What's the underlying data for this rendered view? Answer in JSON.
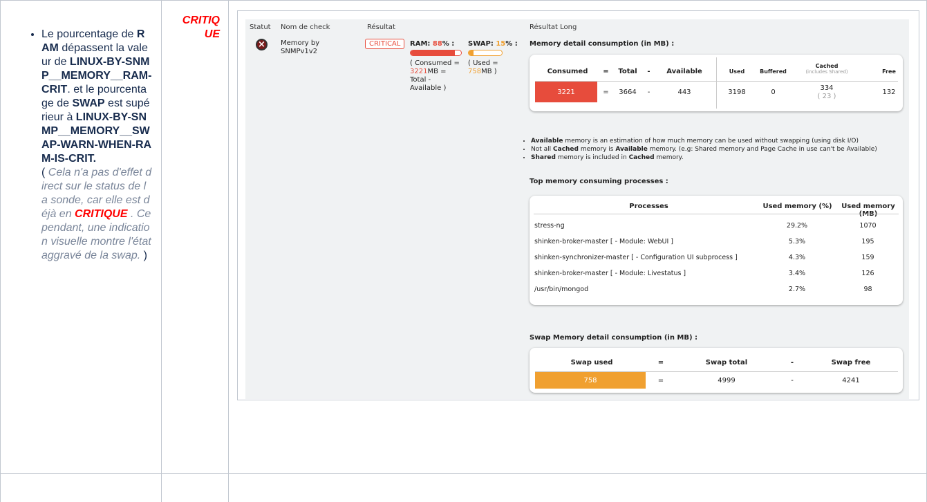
{
  "colors": {
    "critical": "#e74c3c",
    "warning": "#f0a030",
    "border": "#c1c7d0"
  },
  "column1": {
    "t1": "Le pourcentage de ",
    "b1": "RAM",
    "t2": " dépassent la valeur de ",
    "b2": "LINUX-BY-SNMP__MEMORY__RAM-CRIT",
    "t3": ". et le pourcentage de ",
    "b3": "SWAP",
    "t4": " est supérieur à ",
    "b4": "LINUX-BY-SNMP__MEMORY__SWAP-WARN-WHEN-RAM-IS-CRIT.",
    "paren_open": "(",
    "g1": "Cela n'a pas d'effet direct sur le status de la sonde, car elle est déjà en ",
    "red": "CRITIQUE",
    "g2": " . Cependant,  une indication visuelle montre l'état aggravé de la swap.",
    "paren_close": " )"
  },
  "column2": {
    "status": "CRITIQUE"
  },
  "check": {
    "headers": {
      "status": "Statut",
      "name": "Nom de check",
      "result": "Résultat",
      "long": "Résultat Long"
    },
    "status_icon": "x-circle-icon",
    "name_line1": "Memory by",
    "name_line2": "SNMPv1v2",
    "badge": "CRITICAL",
    "ram": {
      "label": "RAM: ",
      "pct": "88",
      "pct_suffix": "% :",
      "fill": 0.88,
      "d1": "( Consumed =",
      "d2_val": "3221",
      "d2_unit": "MB =",
      "d3": "Total -",
      "d4": "Available )"
    },
    "swap": {
      "label": "SWAP: ",
      "pct": "15",
      "pct_suffix": "% :",
      "fill": 0.15,
      "d1": "( Used =",
      "d2_val": "758",
      "d2_unit": "MB )"
    }
  },
  "memory": {
    "title": "Memory detail consumption (in MB) :",
    "headers": {
      "consumed": "Consumed",
      "eq": "=",
      "total": "Total",
      "minus": "-",
      "available": "Available",
      "used": "Used",
      "buffered": "Buffered",
      "cached": "Cached",
      "cached_sub": "(includes Shared)",
      "free": "Free"
    },
    "values": {
      "consumed": "3221",
      "eq": "=",
      "total": "3664",
      "minus": "-",
      "available": "443",
      "used": "3198",
      "buffered": "0",
      "cached": "334",
      "shared": "( 23 )",
      "free": "132"
    },
    "notes": [
      {
        "b": "Available",
        "t": " memory is an estimation of how much memory can be used without swapping (using disk I/O)"
      },
      {
        "t1": "Not all ",
        "b1": "Cached",
        "t2": " memory is ",
        "b2": "Available",
        "t3": " memory. (e.g: Shared memory and Page Cache in use can't be Available)"
      },
      {
        "b": "Shared",
        "t1": " memory is included in ",
        "b2": "Cached",
        "t2": " memory."
      }
    ]
  },
  "processes": {
    "title": "Top memory consuming processes :",
    "headers": {
      "name": "Processes",
      "pct": "Used memory (%)",
      "mb": "Used memory (MB)"
    },
    "rows": [
      {
        "name": "stress-ng",
        "pct": "29.2%",
        "mb": "1070"
      },
      {
        "name": "shinken-broker-master [ - Module: WebUI ]",
        "pct": "5.3%",
        "mb": "195"
      },
      {
        "name": "shinken-synchronizer-master [ - Configuration UI subprocess ]",
        "pct": "4.3%",
        "mb": "159"
      },
      {
        "name": "shinken-broker-master [ - Module: Livestatus ]",
        "pct": "3.4%",
        "mb": "126"
      },
      {
        "name": "/usr/bin/mongod",
        "pct": "2.7%",
        "mb": "98"
      }
    ]
  },
  "swap_detail": {
    "title": "Swap Memory detail consumption (in MB) :",
    "headers": {
      "used": "Swap used",
      "eq": "=",
      "total": "Swap total",
      "minus": "-",
      "free": "Swap free"
    },
    "values": {
      "used": "758",
      "eq": "=",
      "total": "4999",
      "minus": "-",
      "free": "4241"
    }
  }
}
